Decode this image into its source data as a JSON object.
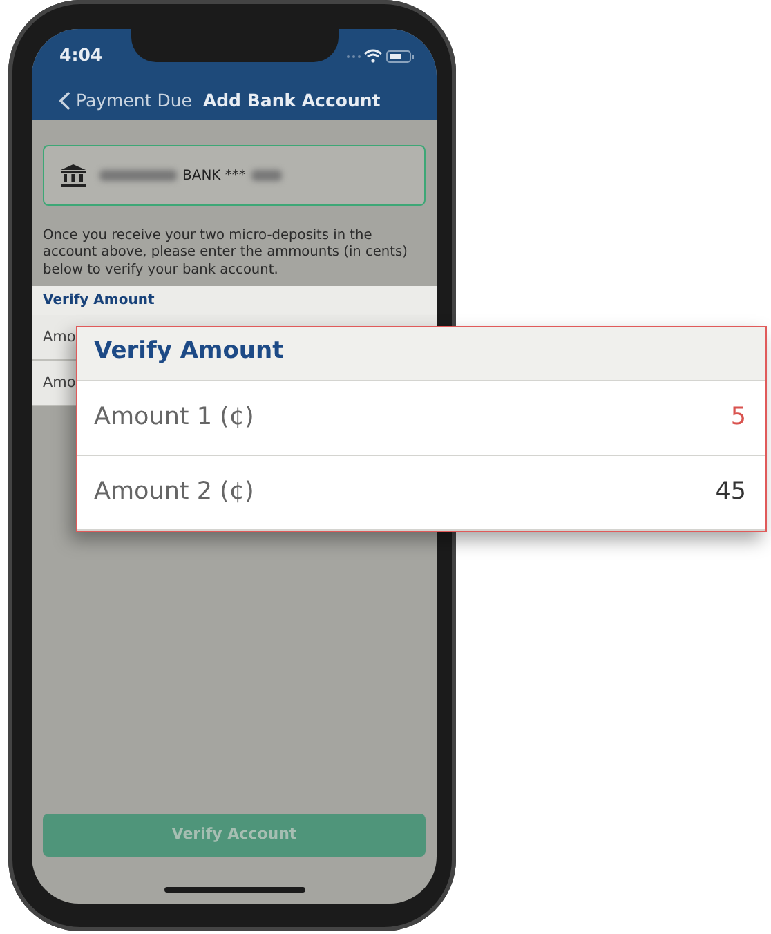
{
  "status_bar": {
    "time": "4:04"
  },
  "nav": {
    "back_label": "Payment Due",
    "title": "Add Bank Account"
  },
  "bank_account": {
    "label": "BANK ***"
  },
  "instructions": "Once you receive your two micro-deposits in the account above, please enter the ammounts (in cents) below to verify your bank account.",
  "section": {
    "title": "Verify Amount",
    "rows": [
      {
        "label": "Amo"
      },
      {
        "label": "Amo"
      }
    ]
  },
  "callout": {
    "title": "Verify Amount",
    "rows": [
      {
        "label": "Amount 1 (¢)",
        "value": "5",
        "invalid": true
      },
      {
        "label": "Amount 2 (¢)",
        "value": "45",
        "invalid": false
      }
    ]
  },
  "button": {
    "label": "Verify Account"
  }
}
